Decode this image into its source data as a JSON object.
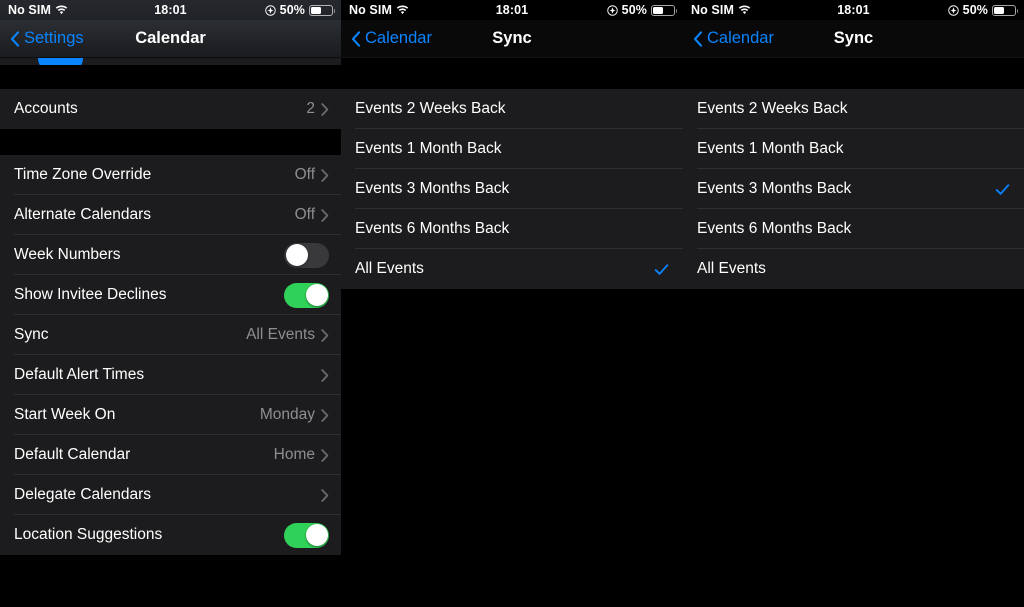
{
  "statusbar": {
    "carrier": "No SIM",
    "time": "18:01",
    "battery_percent": "50%",
    "wifi_icon": "wifi-icon",
    "location_icon": "location-services-icon",
    "battery_icon": "battery-icon"
  },
  "colors": {
    "accent_blue": "#0a84ff",
    "toggle_on_green": "#30d158",
    "row_background": "#1c1c1e",
    "page_background": "#000000",
    "separator": "#2f2f31",
    "secondary_text": "#8d8d93"
  },
  "left_panel": {
    "nav": {
      "back_label": "Settings",
      "title": "Calendar",
      "back_icon": "chevron-left-icon"
    },
    "groups": [
      {
        "rows": [
          {
            "label": "Accounts",
            "value": "2",
            "accessory": "chevron"
          }
        ]
      },
      {
        "rows": [
          {
            "label": "Time Zone Override",
            "value": "Off",
            "accessory": "chevron"
          },
          {
            "label": "Alternate Calendars",
            "value": "Off",
            "accessory": "chevron"
          },
          {
            "label": "Week Numbers",
            "value": "",
            "accessory": "toggle-off"
          },
          {
            "label": "Show Invitee Declines",
            "value": "",
            "accessory": "toggle-on"
          },
          {
            "label": "Sync",
            "value": "All Events",
            "accessory": "chevron"
          },
          {
            "label": "Default Alert Times",
            "value": "",
            "accessory": "chevron"
          },
          {
            "label": "Start Week On",
            "value": "Monday",
            "accessory": "chevron"
          },
          {
            "label": "Default Calendar",
            "value": "Home",
            "accessory": "chevron"
          },
          {
            "label": "Delegate Calendars",
            "value": "",
            "accessory": "chevron"
          },
          {
            "label": "Location Suggestions",
            "value": "",
            "accessory": "toggle-on"
          }
        ]
      }
    ]
  },
  "middle_panel": {
    "nav": {
      "back_label": "Calendar",
      "title": "Sync",
      "back_icon": "chevron-left-icon"
    },
    "options": [
      {
        "label": "Events 2 Weeks Back",
        "selected": false
      },
      {
        "label": "Events 1 Month Back",
        "selected": false
      },
      {
        "label": "Events 3 Months Back",
        "selected": false
      },
      {
        "label": "Events 6 Months Back",
        "selected": false
      },
      {
        "label": "All Events",
        "selected": true
      }
    ]
  },
  "right_panel": {
    "nav": {
      "back_label": "Calendar",
      "title": "Sync",
      "back_icon": "chevron-left-icon"
    },
    "options": [
      {
        "label": "Events 2 Weeks Back",
        "selected": false
      },
      {
        "label": "Events 1 Month Back",
        "selected": false
      },
      {
        "label": "Events 3 Months Back",
        "selected": true
      },
      {
        "label": "Events 6 Months Back",
        "selected": false
      },
      {
        "label": "All Events",
        "selected": false
      }
    ]
  }
}
